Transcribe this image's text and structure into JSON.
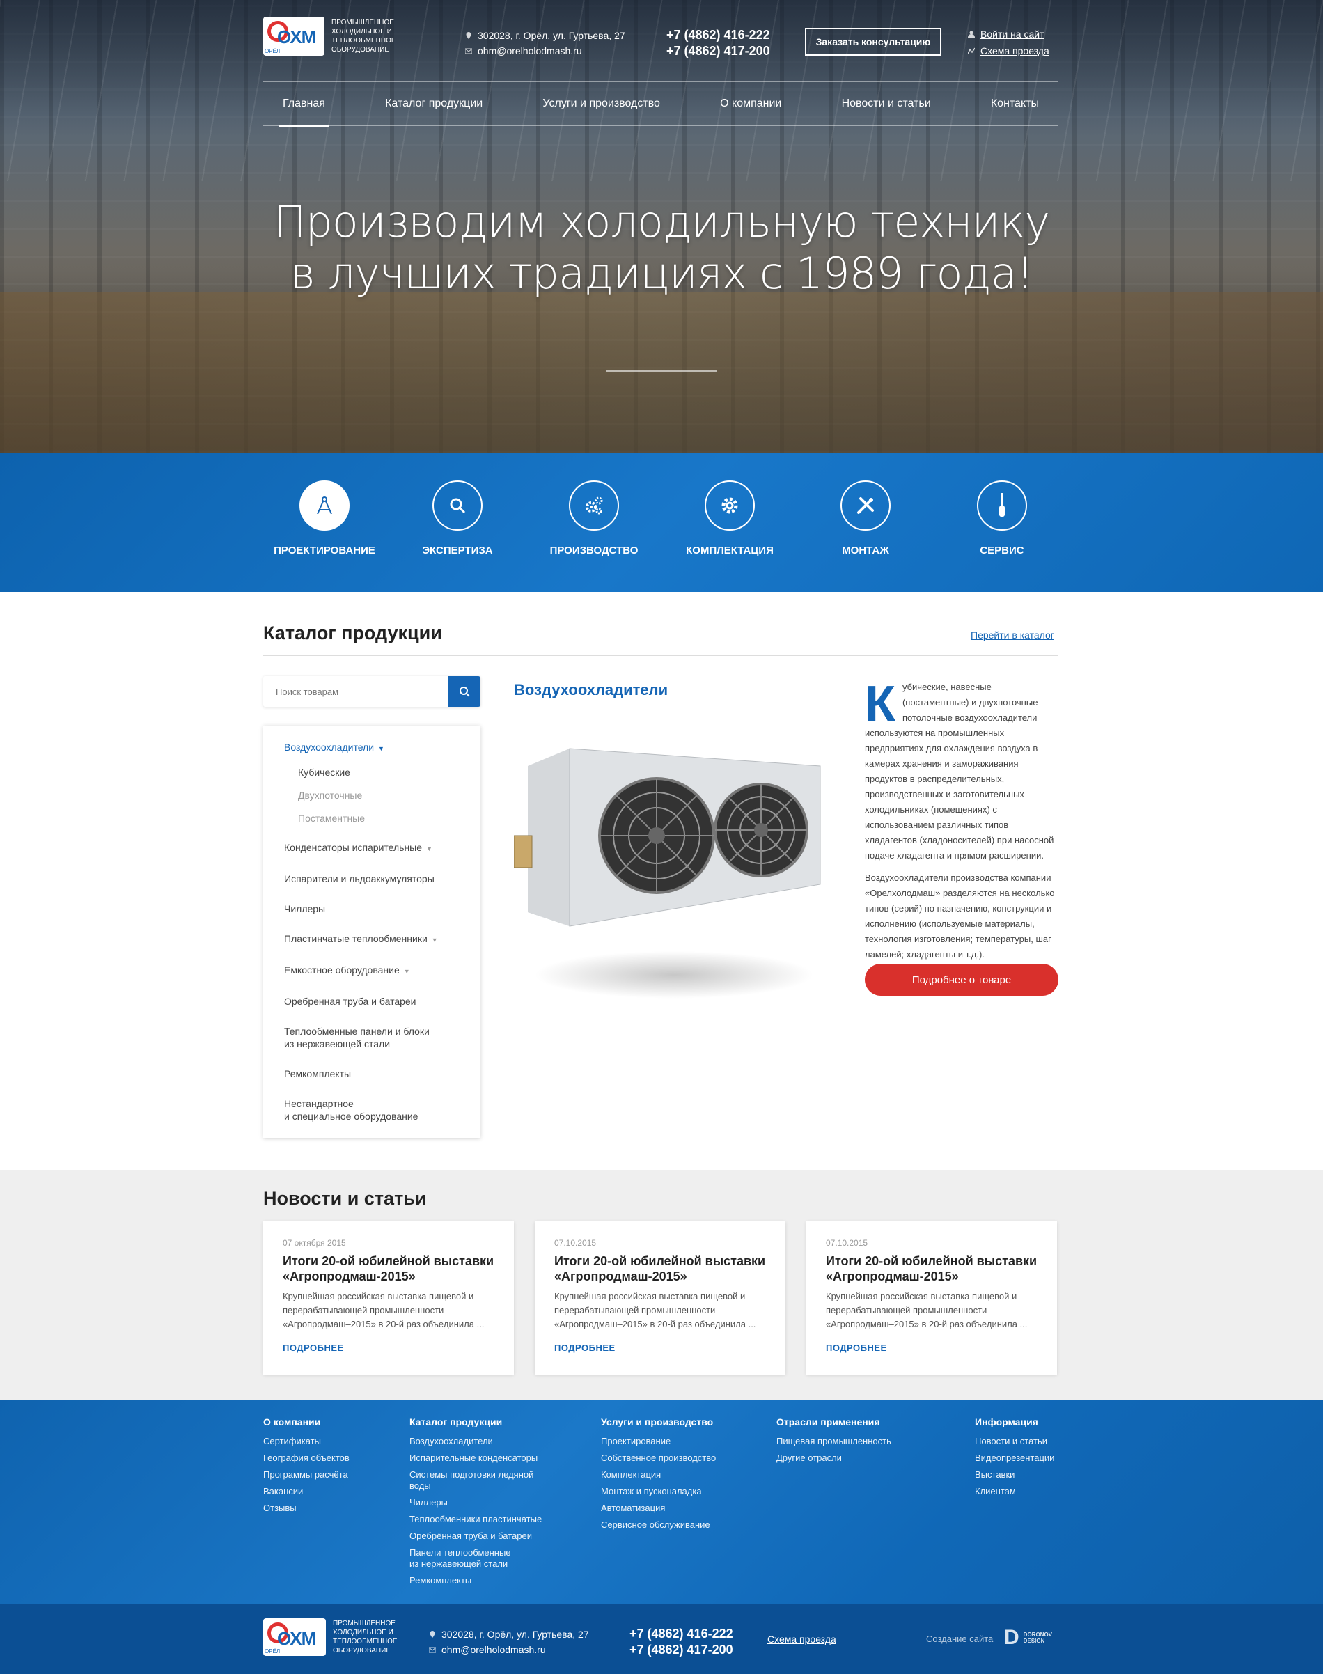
{
  "header": {
    "logo_caption": "Промышленное холодильное и теплообменное оборудование",
    "logo_text": "ОХМ",
    "logo_city": "ОРЁЛ",
    "address": "302028, г. Орёл, ул. Гуртьева, 27",
    "email": "ohm@orelholodmash.ru",
    "phone1": "+7 (4862) 416-222",
    "phone2": "+7 (4862) 417-200",
    "consult_button": "Заказать консультацию",
    "login": "Войти на сайт",
    "scheme": "Схема проезда"
  },
  "nav": [
    {
      "label": "Главная",
      "active": true
    },
    {
      "label": "Каталог продукции"
    },
    {
      "label": "Услуги и производство"
    },
    {
      "label": "О компании"
    },
    {
      "label": "Новости и статьи"
    },
    {
      "label": "Контакты"
    }
  ],
  "hero": {
    "line1": "Производим холодильную технику",
    "line2": "в лучших традициях с 1989 года!"
  },
  "services": [
    {
      "label": "Проектирование",
      "icon": "compass-icon"
    },
    {
      "label": "Экспертиза",
      "icon": "search-icon"
    },
    {
      "label": "Производство",
      "icon": "gears-icon"
    },
    {
      "label": "Комплектация",
      "icon": "gear-icon"
    },
    {
      "label": "Монтаж",
      "icon": "tools-icon"
    },
    {
      "label": "Сервис",
      "icon": "screwdriver-icon"
    }
  ],
  "catalog": {
    "title": "Каталог продукции",
    "link": "Перейти в каталог",
    "search_placeholder": "Поиск товарам",
    "items": [
      "Воздухоохладители",
      "Кубические",
      "Двухпоточные",
      "Постаментные",
      "Конденсаторы испарительные",
      "Испарители и льдоаккумуляторы",
      "Чиллеры",
      "Пластинчатые теплообменники",
      "Емкостное оборудование",
      "Оребренная труба и батареи",
      "Теплообменные панели и блоки",
      "из нержавеющей стали",
      "Ремкомплекты",
      "Нестандартное",
      "и специальное оборудование"
    ],
    "product_title": "Воздухоохладители",
    "desc_cap": "К",
    "desc1": "убические, навесные (постаментные) и двухпоточные потолочные воздухоохладители используются на промышленных предприятиях для охлаждения воздуха в камерах хранения и замораживания продуктов в распределительных, производственных и заготовительных холодильниках (помещениях) с использованием различных типов хладагентов (хладоносителей) при насосной подаче хладагента и прямом расширении.",
    "desc2": "Воздухоохладители производства компании «Орелхолодмаш» разделяются на несколько типов (серий) по назначению, конструкции и исполнению (используемые материалы, технология изготовления; температуры, шаг ламелей; хладагенты и т.д.).",
    "more_button": "Подробнее о товаре"
  },
  "news": {
    "title": "Новости и статьи",
    "cards": [
      {
        "date": "07 октября 2015",
        "title": "Итоги 20-ой юбилейной выставки «Агропродмаш-2015»",
        "text": "Крупнейшая российская выставка пищевой и перерабатывающей промышленности «Агропродмаш–2015» в 20-й раз объединила ...",
        "more": "ПОДРОБНЕЕ"
      },
      {
        "date": "07.10.2015",
        "title": "Итоги 20-ой юбилейной выставки «Агропродмаш-2015»",
        "text": "Крупнейшая российская выставка пищевой и перерабатывающей промышленности «Агропродмаш–2015» в 20-й раз объединила ...",
        "more": "ПОДРОБНЕЕ"
      },
      {
        "date": "07.10.2015",
        "title": "Итоги 20-ой юбилейной выставки «Агропродмаш-2015»",
        "text": "Крупнейшая российская выставка пищевой и перерабатывающей промышленности «Агропродмаш–2015» в 20-й раз объединила ...",
        "more": "ПОДРОБНЕЕ"
      }
    ]
  },
  "footer": {
    "cols": [
      {
        "title": "О компании",
        "links": [
          "Сертификаты",
          "География объектов",
          "Программы расчёта",
          "Вакансии",
          "Отзывы"
        ]
      },
      {
        "title": "Каталог продукции",
        "links": [
          "Воздухоохладители",
          "Испарительные конденсаторы",
          "Системы подготовки ледяной воды",
          "Чиллеры",
          "Теплообменники пластинчатые",
          "Оребрённая труба и батареи",
          "Панели теплообменные из нержавеющей стали",
          "Ремкомплекты"
        ]
      },
      {
        "title": "Услуги и производство",
        "links": [
          "Проектирование",
          "Собственное производство",
          "Комплектация",
          "Монтаж и пусконаладка",
          "Автоматизация",
          "Сервисное обслуживание"
        ]
      },
      {
        "title": "Отрасли применения",
        "links": [
          "Пищевая промышленность",
          "Другие отрасли"
        ]
      },
      {
        "title": "Информация",
        "links": [
          "Новости и статьи",
          "Видеопрезентации",
          "Выставки",
          "Клиентам"
        ]
      }
    ],
    "created": "Создание сайта",
    "designer": "DORONOV DESIGN",
    "designer_mark": "D"
  }
}
